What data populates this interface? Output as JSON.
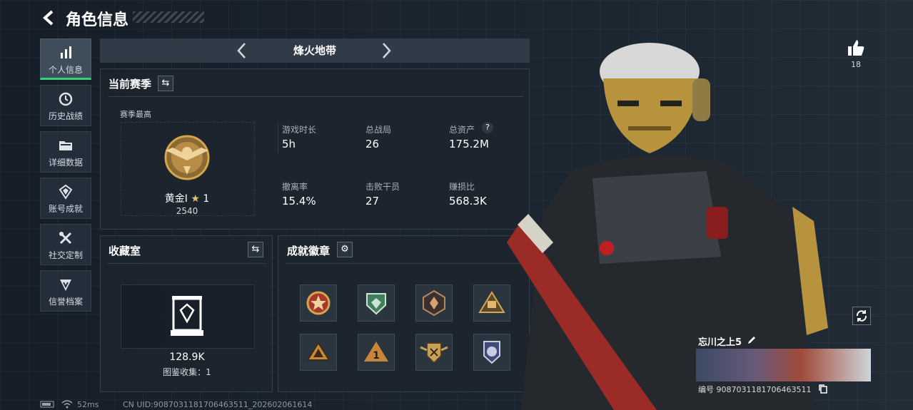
{
  "header": {
    "title": "角色信息"
  },
  "sidebar": {
    "items": [
      {
        "label": "个人信息",
        "icon": "bar-chart-icon"
      },
      {
        "label": "历史战绩",
        "icon": "clock-icon"
      },
      {
        "label": "详细数据",
        "icon": "folder-icon"
      },
      {
        "label": "账号成就",
        "icon": "achievement-icon"
      },
      {
        "label": "社交定制",
        "icon": "tools-icon"
      },
      {
        "label": "信誉档案",
        "icon": "shield-icon"
      }
    ]
  },
  "season_bar": {
    "name": "烽火地带"
  },
  "current_season": {
    "title": "当前赛季",
    "best_label": "赛季最高",
    "rank_name": "黄金Ⅰ",
    "rank_star": "1",
    "rank_points": "2540",
    "stats": [
      {
        "label": "游戏时长",
        "value": "5h"
      },
      {
        "label": "总战局",
        "value": "26"
      },
      {
        "label": "总资产",
        "value": "175.2M"
      },
      {
        "label": "撤离率",
        "value": "15.4%"
      },
      {
        "label": "击败干员",
        "value": "27"
      },
      {
        "label": "赚损比",
        "value": "568.3K"
      }
    ],
    "help": "?"
  },
  "collection": {
    "title": "收藏室",
    "value": "128.9K",
    "catalog": "图鉴收集：1"
  },
  "achievements": {
    "title": "成就徽章"
  },
  "profile": {
    "likes": "18",
    "name": "忘川之上5",
    "id_text": "编号 9087031181706463511"
  },
  "status_bar": {
    "ping": "52ms",
    "uid": "CN UID:9087031181706463511_202602061614"
  },
  "colors": {
    "accent": "#38d07a",
    "gold": "#d5a64a"
  }
}
